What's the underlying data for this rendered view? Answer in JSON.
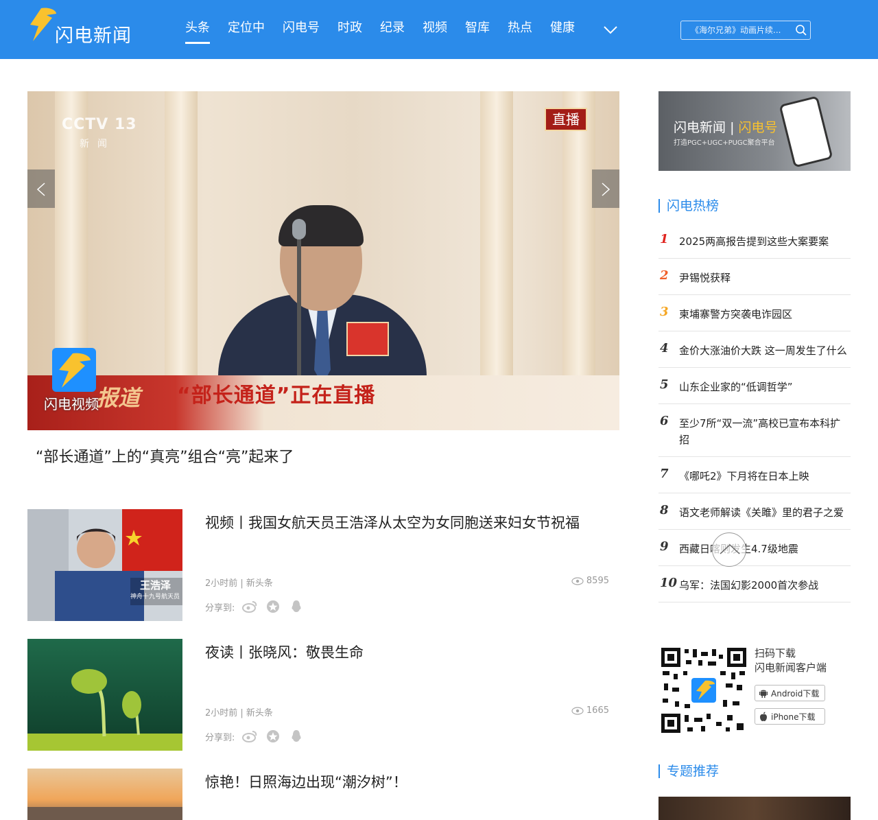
{
  "header": {
    "logo_text": "闪电新闻",
    "nav": [
      {
        "label": "头条",
        "active": true
      },
      {
        "label": "定位中"
      },
      {
        "label": "闪电号"
      },
      {
        "label": "时政"
      },
      {
        "label": "纪录"
      },
      {
        "label": "视频"
      },
      {
        "label": "智库"
      },
      {
        "label": "热点"
      },
      {
        "label": "健康"
      }
    ],
    "more_icon": "chevron-down-icon",
    "search_placeholder": "《海尔兄弟》动画片续...",
    "search_icon": "search-icon",
    "bar_color": "#2b8bea"
  },
  "hero": {
    "watermark": "CCTV 13",
    "watermark_sub": "新闻",
    "live_tag": "直播",
    "banner_script": "报道",
    "banner_text": "“部长通道”正在直播",
    "video_logo_text": "闪电视频",
    "caption": "“部长通道”上的“真亮”组合“亮”起来了"
  },
  "news": [
    {
      "title": "视频丨我国女航天员王浩泽从太空为女同胞送来妇女节祝福",
      "meta": "2小时前 | 新头条",
      "views": "8595",
      "share_label": "分享到:",
      "thumb_caption": "王浩泽",
      "thumb_sub": "神舟十九号航天员"
    },
    {
      "title": "夜读丨张晓风：敬畏生命",
      "meta": "2小时前 | 新头条",
      "views": "1665",
      "share_label": "分享到:"
    },
    {
      "title": "惊艳！日照海边出现“潮汐树”！"
    }
  ],
  "sidebar": {
    "promo_title_a": "闪电新闻",
    "promo_title_sep": "|",
    "promo_title_b": "闪电号",
    "promo_sub": "打造PGC+UGC+PUGC聚合平台",
    "hot_title": "闪电热榜",
    "hot": [
      {
        "rank": "1",
        "text": "2025两高报告提到这些大案要案"
      },
      {
        "rank": "2",
        "text": "尹锡悦获释"
      },
      {
        "rank": "3",
        "text": "柬埔寨警方突袭电诈园区"
      },
      {
        "rank": "4",
        "text": "金价大涨油价大跌 这一周发生了什么"
      },
      {
        "rank": "5",
        "text": "山东企业家的“低调哲学”"
      },
      {
        "rank": "6",
        "text": "至少7所“双一流”高校已宣布本科扩招"
      },
      {
        "rank": "7",
        "text": "《哪吒2》下月将在日本上映"
      },
      {
        "rank": "8",
        "text": "语文老师解读《关雎》里的君子之爱"
      },
      {
        "rank": "9",
        "text": "西藏日喀则发生4.7级地震"
      },
      {
        "rank": "10",
        "text": "乌军：法国幻影2000首次参战"
      }
    ],
    "qr_line1": "扫码下载",
    "qr_line2": "闪电新闻客户端",
    "android_label": "Android下载",
    "iphone_label": "iPhone下载",
    "topic_title": "专题推荐"
  }
}
